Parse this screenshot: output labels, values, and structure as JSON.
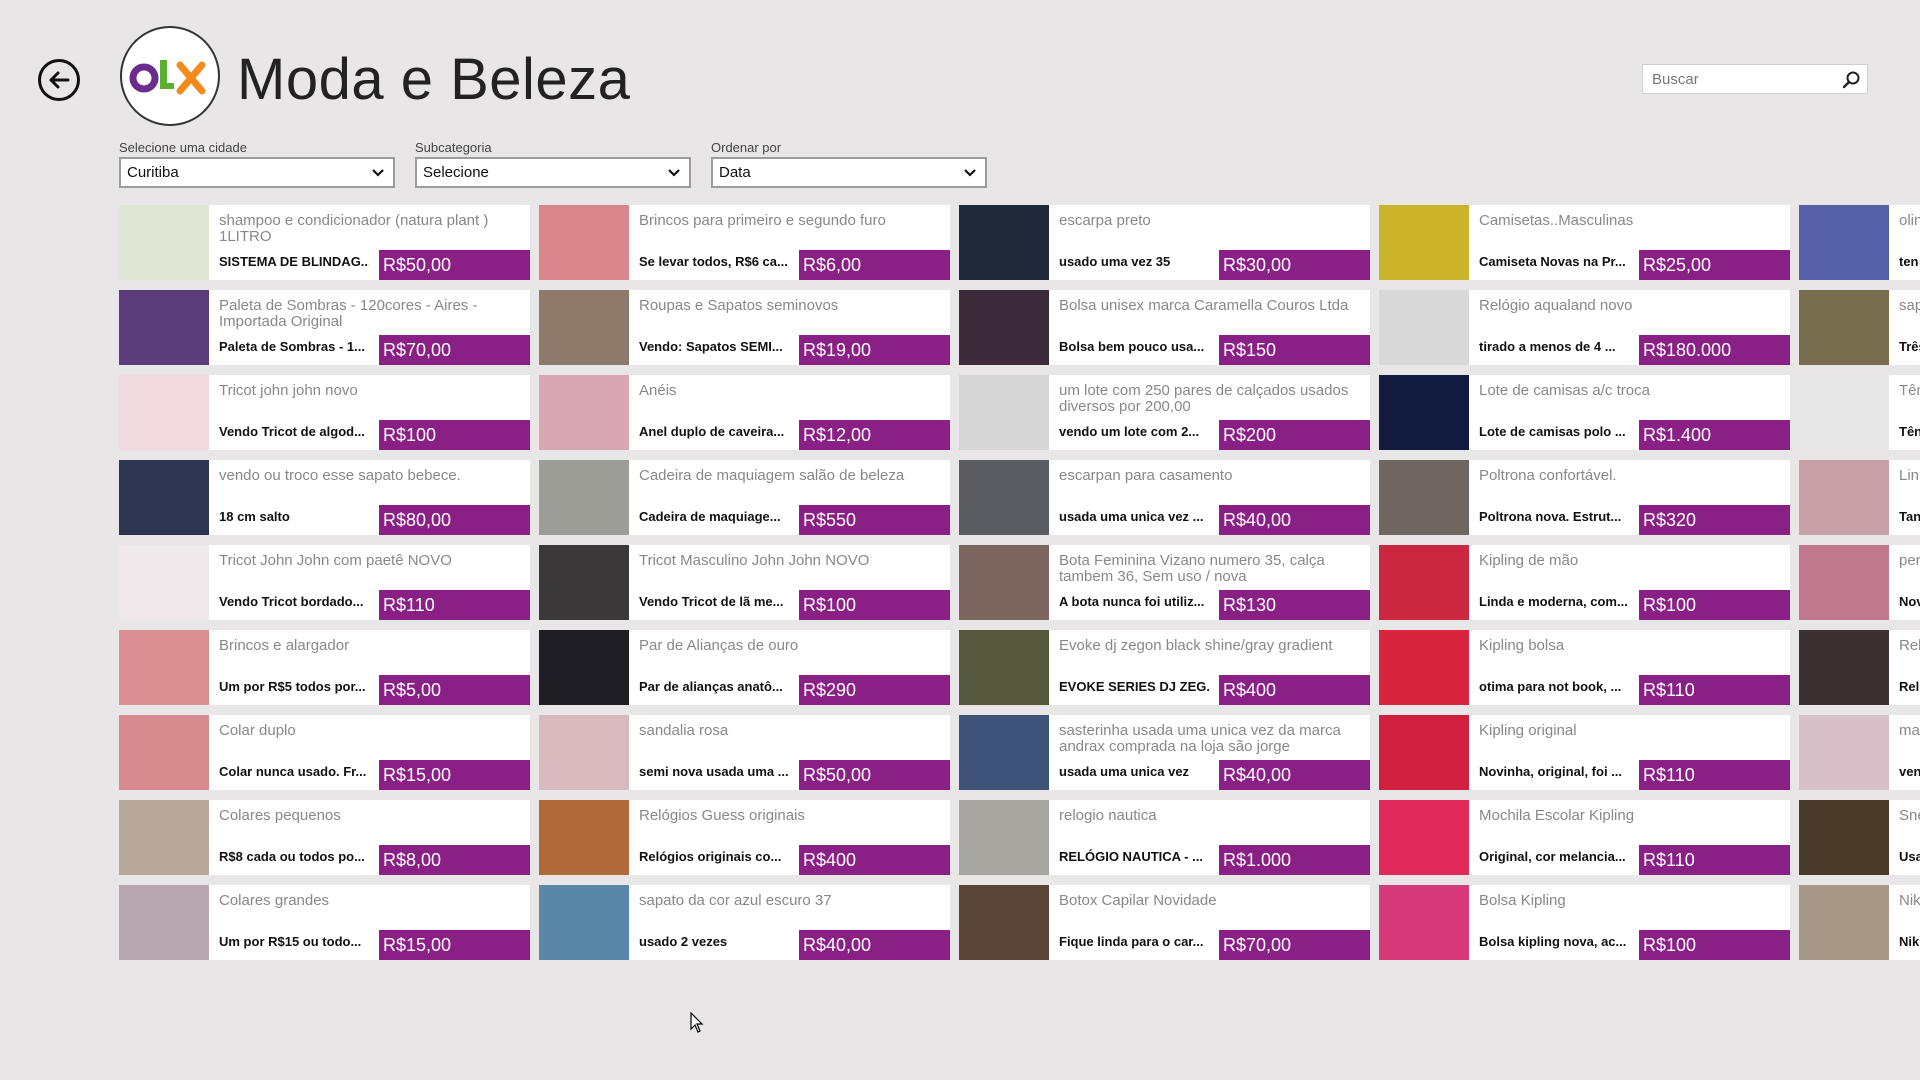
{
  "header": {
    "title": "Moda e Beleza",
    "logo_text": "OLX",
    "search_placeholder": "Buscar"
  },
  "filters": [
    {
      "label": "Selecione uma cidade",
      "value": "Curitiba"
    },
    {
      "label": "Subcategoria",
      "value": "Selecione"
    },
    {
      "label": "Ordenar por",
      "value": "Data"
    }
  ],
  "colors": {
    "accent": "#8a1f86",
    "background": "#e8e6e6"
  },
  "listings": [
    {
      "title": "shampoo e condicionador (natura plant ) 1LITRO",
      "desc": "SISTEMA DE BLINDAG...",
      "price": "R$50,00",
      "thumb": "#dfe6d5"
    },
    {
      "title": "Paleta de Sombras - 120cores - Aires - Importada Original",
      "desc": "Paleta de Sombras - 1...",
      "price": "R$70,00",
      "thumb": "#5a3d7a"
    },
    {
      "title": "Tricot john john novo",
      "desc": "Vendo Tricot de algod...",
      "price": "R$100",
      "thumb": "#f0d9df"
    },
    {
      "title": "vendo ou troco esse sapato bebece.",
      "desc": "18 cm salto",
      "price": "R$80,00",
      "thumb": "#2d3550"
    },
    {
      "title": "Tricot John John com paetê NOVO",
      "desc": "Vendo Tricot bordado...",
      "price": "R$110",
      "thumb": "#efe8ea"
    },
    {
      "title": "Brincos e alargador",
      "desc": "Um por R$5 todos por...",
      "price": "R$5,00",
      "thumb": "#d98f92"
    },
    {
      "title": "Colar duplo",
      "desc": "Colar nunca usado. Fr...",
      "price": "R$15,00",
      "thumb": "#d88b8e"
    },
    {
      "title": "Colares pequenos",
      "desc": "R$8 cada ou todos po...",
      "price": "R$8,00",
      "thumb": "#b7a89a"
    },
    {
      "title": "Colares grandes",
      "desc": "Um por R$15 ou todo...",
      "price": "R$15,00",
      "thumb": "#b8a6b0"
    },
    {
      "title": "Brincos para primeiro e segundo furo",
      "desc": "Se levar todos, R$6 ca...",
      "price": "R$6,00",
      "thumb": "#d9868c"
    },
    {
      "title": "Roupas e Sapatos seminovos",
      "desc": "Vendo: Sapatos SEMI...",
      "price": "R$19,00",
      "thumb": "#8e7a6a"
    },
    {
      "title": "Anéis",
      "desc": "Anel duplo de caveira...",
      "price": "R$12,00",
      "thumb": "#d9a7b4"
    },
    {
      "title": "Cadeira de maquiagem salão de beleza",
      "desc": "Cadeira de maquiage...",
      "price": "R$550",
      "thumb": "#9d9d98"
    },
    {
      "title": "Tricot Masculino John John NOVO",
      "desc": "Vendo Tricot de lã me...",
      "price": "R$100",
      "thumb": "#3a3838"
    },
    {
      "title": "Par de Alianças de ouro",
      "desc": "Par de alianças anatô...",
      "price": "R$290",
      "thumb": "#1e1e24"
    },
    {
      "title": "sandalia rosa",
      "desc": "semi nova usada uma ...",
      "price": "R$50,00",
      "thumb": "#d8b9bd"
    },
    {
      "title": "Relógios Guess originais",
      "desc": "Relógios originais co...",
      "price": "R$400",
      "thumb": "#b06a3a"
    },
    {
      "title": "sapato da cor azul escuro 37",
      "desc": "usado 2 vezes",
      "price": "R$40,00",
      "thumb": "#5a86a8"
    },
    {
      "title": "escarpa preto",
      "desc": "usado uma vez 35",
      "price": "R$30,00",
      "thumb": "#1f2838"
    },
    {
      "title": "Bolsa unisex marca Caramella Couros Ltda",
      "desc": "Bolsa bem pouco usa...",
      "price": "R$150",
      "thumb": "#3d2b3a"
    },
    {
      "title": "um lote com 250 pares de calçados usados diversos por 200,00",
      "desc": "vendo um lote com 2...",
      "price": "R$200",
      "thumb": "#d6d6d6"
    },
    {
      "title": "escarpan para casamento",
      "desc": "usada uma unica vez ...",
      "price": "R$40,00",
      "thumb": "#5b5c61"
    },
    {
      "title": "Bota Feminina Vizano numero 35, calça tambem 36, Sem uso / nova",
      "desc": "A bota nunca foi utiliz...",
      "price": "R$130",
      "thumb": "#7d6560"
    },
    {
      "title": "Evoke dj zegon black shine/gray gradient",
      "desc": "EVOKE SERIES DJ ZEG...",
      "price": "R$400",
      "thumb": "#56583c"
    },
    {
      "title": "sasterinha usada uma unica vez da marca andrax comprada na loja são jorge",
      "desc": "usada uma unica vez",
      "price": "R$40,00",
      "thumb": "#3e5478"
    },
    {
      "title": "relogio nautica",
      "desc": "RELÓGIO NAUTICA - ...",
      "price": "R$1.000",
      "thumb": "#a8a6a0"
    },
    {
      "title": "Botox Capilar Novidade",
      "desc": "Fique linda para o car...",
      "price": "R$70,00",
      "thumb": "#5a4538"
    },
    {
      "title": "Camisetas..Masculinas",
      "desc": "Camiseta Novas na Pr...",
      "price": "R$25,00",
      "thumb": "#c9b42a"
    },
    {
      "title": "Relógio aqualand novo",
      "desc": "tirado a menos de 4 ...",
      "price": "R$180.000",
      "thumb": "#d8d8d8"
    },
    {
      "title": "Lote de camisas a/c troca",
      "desc": "Lote de camisas polo ...",
      "price": "R$1.400",
      "thumb": "#121a40"
    },
    {
      "title": "Poltrona confortável.",
      "desc": "Poltrona nova. Estrut...",
      "price": "R$320",
      "thumb": "#6e6660"
    },
    {
      "title": "Kipling de mão",
      "desc": "Linda e moderna, com...",
      "price": "R$100",
      "thumb": "#c92840"
    },
    {
      "title": "Kipling bolsa",
      "desc": "otima para not book, ...",
      "price": "R$110",
      "thumb": "#d8243e"
    },
    {
      "title": "Kipling original",
      "desc": "Novinha, original, foi ...",
      "price": "R$110",
      "thumb": "#cf2040"
    },
    {
      "title": "Mochila Escolar Kipling",
      "desc": "Original, cor melancia...",
      "price": "R$110",
      "thumb": "#e0285a"
    },
    {
      "title": "Bolsa Kipling",
      "desc": "Bolsa kipling nova, ac...",
      "price": "R$100",
      "thumb": "#d63a78"
    },
    {
      "title": "olin",
      "desc": "ten",
      "price": "",
      "thumb": "#5560a8"
    },
    {
      "title": "sap",
      "desc": "Três",
      "price": "",
      "thumb": "#7a6e50"
    },
    {
      "title": "Tên",
      "desc": "Tên",
      "price": "",
      "thumb": "#e8e8e8"
    },
    {
      "title": "Lin",
      "desc": "Tan",
      "price": "",
      "thumb": "#c8a0a8"
    },
    {
      "title": "per",
      "desc": "Nov",
      "price": "",
      "thumb": "#c0788e"
    },
    {
      "title": "Rel",
      "desc": "Rel",
      "price": "",
      "thumb": "#3a3232"
    },
    {
      "title": "ma",
      "desc": "ven",
      "price": "",
      "thumb": "#d8c0c8"
    },
    {
      "title": "Sne",
      "desc": "Usa",
      "price": "",
      "thumb": "#4a3a2a"
    },
    {
      "title": "Nik",
      "desc": "Nik",
      "price": "",
      "thumb": "#a89888"
    }
  ]
}
